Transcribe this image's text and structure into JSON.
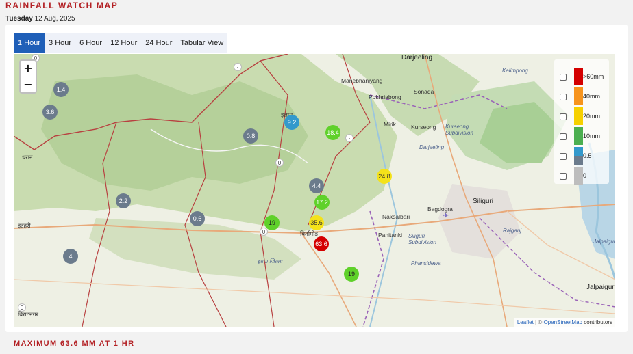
{
  "header": {
    "title": "RAINFALL WATCH MAP",
    "weekday": "Tuesday",
    "date": "12 Aug, 2025"
  },
  "tabs": [
    {
      "label": "1 Hour",
      "active": true
    },
    {
      "label": "3 Hour",
      "active": false
    },
    {
      "label": "6 Hour",
      "active": false
    },
    {
      "label": "12 Hour",
      "active": false
    },
    {
      "label": "24 Hour",
      "active": false
    },
    {
      "label": "Tabular View",
      "active": false
    }
  ],
  "zoom": {
    "in_label": "+",
    "out_label": "−"
  },
  "colors": {
    "accent": "#b32024",
    "tab_active": "#1f5fb8",
    "gt60": "#d40000",
    "mm40": "#f7941d",
    "mm20": "#f6d000",
    "mm10": "#4caf50",
    "mm05": "#3399cc",
    "mm0": "#bdbdbd",
    "grey_station": "#6b7b8c"
  },
  "legend": [
    {
      "label": ">60mm",
      "swatch": "red"
    },
    {
      "label": "40mm",
      "swatch": "orange"
    },
    {
      "label": "20mm",
      "swatch": "yellow"
    },
    {
      "label": "10mm",
      "swatch": "green"
    },
    {
      "label": "0.5",
      "swatch": "blue-grey"
    },
    {
      "label": "0",
      "swatch": "grey"
    }
  ],
  "stations": [
    {
      "value": "1.4",
      "category": "grey"
    },
    {
      "value": "3.6",
      "category": "grey"
    },
    {
      "value": "9.2",
      "category": "blue"
    },
    {
      "value": "0.8",
      "category": "grey"
    },
    {
      "value": "18.4",
      "category": "green"
    },
    {
      "value": "24.8",
      "category": "yellow"
    },
    {
      "value": "4.4",
      "category": "grey"
    },
    {
      "value": "17.2",
      "category": "green"
    },
    {
      "value": "2.2",
      "category": "grey"
    },
    {
      "value": "0.6",
      "category": "grey"
    },
    {
      "value": "19",
      "category": "green"
    },
    {
      "value": "35.6",
      "category": "yellow"
    },
    {
      "value": "63.6",
      "category": "red"
    },
    {
      "value": "4",
      "category": "grey"
    },
    {
      "value": "19",
      "category": "green"
    }
  ],
  "small_markers": [
    "-",
    "-",
    "0",
    "0",
    "0",
    "0"
  ],
  "places": {
    "darjeeling": "Darjeeling",
    "manebhanjyang": "Manebhanjyang",
    "pokhriabong": "Pokhriabong",
    "sonada": "Sonada",
    "mirik": "Mirik",
    "kurseong": "Kurseong",
    "kurseong_sub": "Kurseong Subdivision",
    "darjeeling2": "Darjeeling",
    "siliguri": "Siliguri",
    "bagdogra": "Bagdogra",
    "naksalbari": "Naksalbari",
    "panitanki": "Panitanki",
    "siliguri_sub": "Siliguri Subdivision",
    "phansidewa": "Phansidewa",
    "jalpaiguri1": "Jalpaiguri",
    "jalpaiguri2": "Jalpaiguri",
    "rajganj": "Rajganj",
    "kalimpong": "Kalimpong",
    "ilam": "इलाम",
    "dharan": "धरान",
    "itahari": "इटहरी",
    "birtamod": "बिर्तामोड",
    "jhapa": "झापा जिल्ला",
    "biratnagar": "बिराटनगर"
  },
  "attribution": {
    "leaflet": "Leaflet",
    "sep": " | © ",
    "osm": "OpenStreetMap",
    "tail": " contributors"
  },
  "footer": {
    "max_text": "MAXIMUM 63.6 MM AT 1 HR"
  }
}
